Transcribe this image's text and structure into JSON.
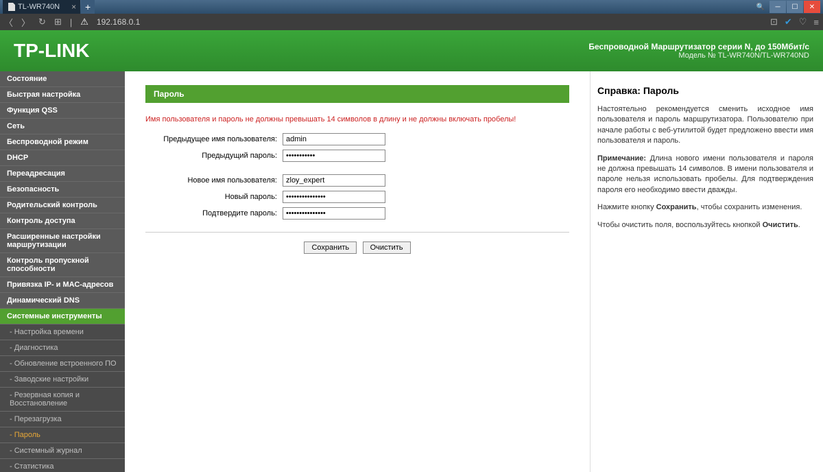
{
  "browser": {
    "tab_title": "TL-WR740N",
    "url": "192.168.0.1"
  },
  "header": {
    "logo": "TP-LINK",
    "line1": "Беспроводной Маршрутизатор серии N, до 150Мбит/с",
    "line2": "Модель № TL-WR740N/TL-WR740ND"
  },
  "sidebar": {
    "items": [
      {
        "label": "Состояние",
        "sub": false
      },
      {
        "label": "Быстрая настройка",
        "sub": false
      },
      {
        "label": "Функция QSS",
        "sub": false
      },
      {
        "label": "Сеть",
        "sub": false
      },
      {
        "label": "Беспроводной режим",
        "sub": false
      },
      {
        "label": "DHCP",
        "sub": false
      },
      {
        "label": "Переадресация",
        "sub": false
      },
      {
        "label": "Безопасность",
        "sub": false
      },
      {
        "label": "Родительский контроль",
        "sub": false
      },
      {
        "label": "Контроль доступа",
        "sub": false
      },
      {
        "label": "Расширенные настройки маршрутизации",
        "sub": false
      },
      {
        "label": "Контроль пропускной способности",
        "sub": false
      },
      {
        "label": "Привязка IP- и МАС-адресов",
        "sub": false
      },
      {
        "label": "Динамический DNS",
        "sub": false
      },
      {
        "label": "Системные инструменты",
        "sub": false,
        "active": true
      },
      {
        "label": "- Настройка времени",
        "sub": true
      },
      {
        "label": "- Диагностика",
        "sub": true
      },
      {
        "label": "- Обновление встроенного ПО",
        "sub": true
      },
      {
        "label": "- Заводские настройки",
        "sub": true
      },
      {
        "label": "- Резервная копия и Восстановление",
        "sub": true
      },
      {
        "label": "- Перезагрузка",
        "sub": true
      },
      {
        "label": "- Пароль",
        "sub": true,
        "current": true
      },
      {
        "label": "- Системный журнал",
        "sub": true
      },
      {
        "label": "- Статистика",
        "sub": true
      }
    ]
  },
  "form": {
    "title": "Пароль",
    "warning": "Имя пользователя и пароль не должны превышать 14 символов в длину и не должны включать пробелы!",
    "old_user_label": "Предыдущее имя пользователя:",
    "old_user_value": "admin",
    "old_pass_label": "Предыдущий пароль:",
    "old_pass_value": "•••••••••••",
    "new_user_label": "Новое имя пользователя:",
    "new_user_value": "zloy_expert",
    "new_pass_label": "Новый пароль:",
    "new_pass_value": "•••••••••••••••",
    "confirm_pass_label": "Подтвердите пароль:",
    "confirm_pass_value": "•••••••••••••••",
    "save_btn": "Сохранить",
    "clear_btn": "Очистить"
  },
  "help": {
    "title": "Справка: Пароль",
    "p1": "Настоятельно рекомендуется сменить исходное имя пользователя и пароль маршрутизатора. Пользователю при начале работы с веб-утилитой будет предложено ввести имя пользователя и пароль.",
    "p2_prefix": "Примечание:",
    "p2": " Длина нового имени пользователя и пароля не должна превышать 14 символов. В имени пользователя и пароле нельзя использовать пробелы. Для подтверждения пароля его необходимо ввести дважды.",
    "p3_a": "Нажмите кнопку ",
    "p3_b": "Сохранить",
    "p3_c": ", чтобы сохранить изменения.",
    "p4_a": "Чтобы очистить поля, воспользуйтесь кнопкой ",
    "p4_b": "Очистить",
    "p4_c": "."
  }
}
